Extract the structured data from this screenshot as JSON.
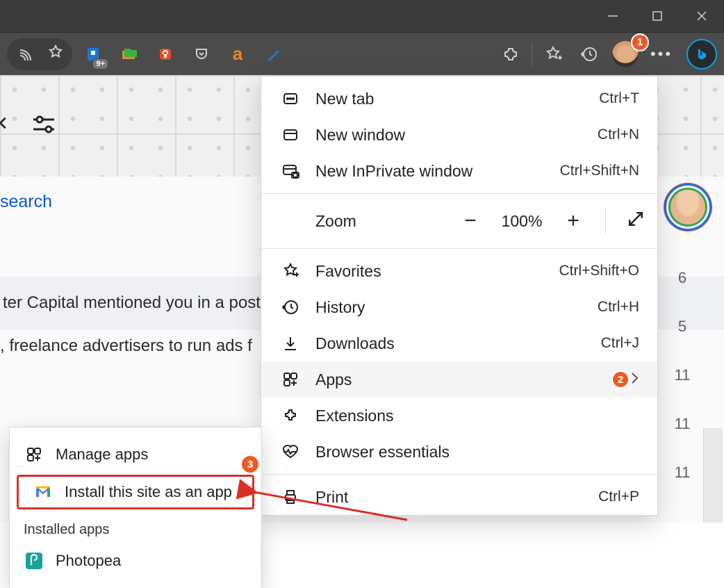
{
  "titlebar": {
    "buttons": [
      "minimize",
      "maximize",
      "close"
    ]
  },
  "toolbar": {
    "icons": [
      {
        "name": "cast-icon"
      },
      {
        "name": "star-icon"
      },
      {
        "name": "privacy-badger-icon",
        "badge": "9+"
      },
      {
        "name": "folders-icon"
      },
      {
        "name": "lock-ext-icon"
      },
      {
        "name": "pocket-icon"
      },
      {
        "name": "a-ext-icon"
      },
      {
        "name": "editor-icon"
      },
      {
        "name": "extensions-puzzle-icon"
      },
      {
        "name": "favorites-star-plus-icon"
      },
      {
        "name": "history-icon"
      },
      {
        "name": "profile-avatar"
      },
      {
        "name": "more-icon"
      },
      {
        "name": "bing-chat-icon"
      }
    ],
    "badges": {
      "profile": "1"
    }
  },
  "page": {
    "search_label": "search",
    "bar1_text": "ter Capital mentioned you in a post",
    "bar2_text": ", freelance advertisers to run ads f",
    "right_numbers": [
      "6",
      "5",
      "11",
      "11",
      "11"
    ]
  },
  "menu": {
    "items": [
      {
        "icon": "new-tab-icon",
        "label": "New tab",
        "shortcut": "Ctrl+T"
      },
      {
        "icon": "new-window-icon",
        "label": "New window",
        "shortcut": "Ctrl+N"
      },
      {
        "icon": "inprivate-icon",
        "label": "New InPrivate window",
        "shortcut": "Ctrl+Shift+N"
      }
    ],
    "zoom": {
      "label": "Zoom",
      "value": "100%"
    },
    "items2": [
      {
        "icon": "favorites-icon",
        "label": "Favorites",
        "shortcut": "Ctrl+Shift+O"
      },
      {
        "icon": "history-icon",
        "label": "History",
        "shortcut": "Ctrl+H"
      },
      {
        "icon": "downloads-icon",
        "label": "Downloads",
        "shortcut": "Ctrl+J"
      },
      {
        "icon": "apps-icon",
        "label": "Apps",
        "submenu": true,
        "highlight": true,
        "badge": "2"
      },
      {
        "icon": "extensions-icon",
        "label": "Extensions"
      },
      {
        "icon": "essentials-icon",
        "label": "Browser essentials"
      }
    ],
    "items3": [
      {
        "icon": "print-icon",
        "label": "Print",
        "shortcut": "Ctrl+P"
      }
    ]
  },
  "submenu": {
    "items": [
      {
        "icon": "manage-apps-icon",
        "label": "Manage apps"
      },
      {
        "icon": "gmail-icon",
        "label": "Install this site as an app",
        "red": true
      }
    ],
    "header": "Installed apps",
    "installed": [
      {
        "icon": "photopea-icon",
        "label": "Photopea"
      }
    ],
    "badge": "3"
  }
}
